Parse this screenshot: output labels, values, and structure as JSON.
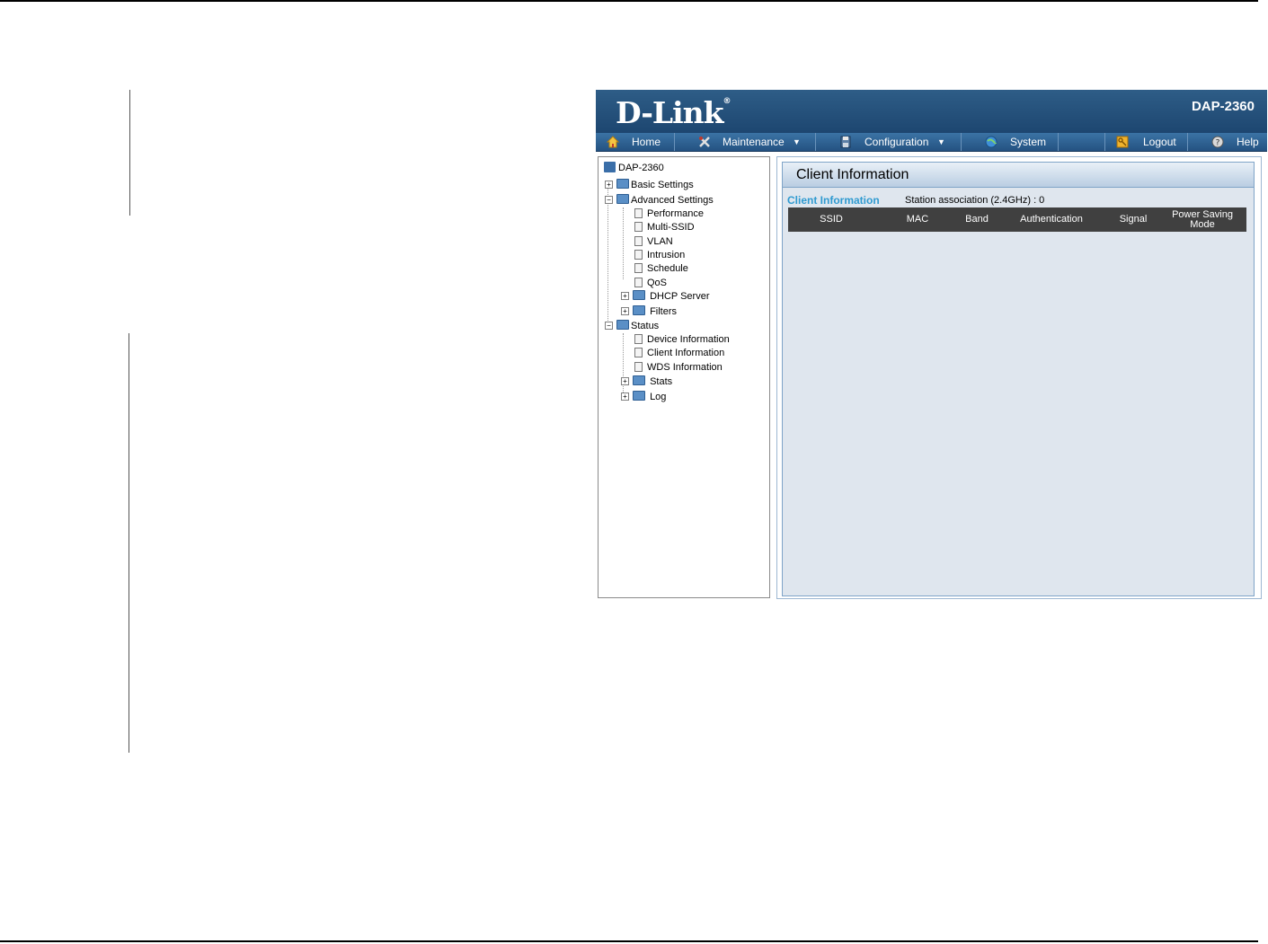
{
  "header": {
    "logo_text": "D-Link",
    "logo_mark": "®",
    "model": "DAP-2360"
  },
  "menu": {
    "items": [
      {
        "label": "Home",
        "icon": "home-icon"
      },
      {
        "label": "Maintenance",
        "icon": "tools-icon",
        "dropdown": true
      },
      {
        "label": "Configuration",
        "icon": "disk-icon",
        "dropdown": true
      },
      {
        "label": "System",
        "icon": "globe-icon"
      },
      {
        "label": "Logout",
        "icon": "key-icon"
      },
      {
        "label": "Help",
        "icon": "help-icon"
      }
    ]
  },
  "tree": {
    "root": "DAP-2360",
    "basic_settings": "Basic Settings",
    "advanced_settings": "Advanced Settings",
    "advanced_children": [
      "Performance",
      "Multi-SSID",
      "VLAN",
      "Intrusion",
      "Schedule",
      "QoS"
    ],
    "dhcp_server": "DHCP Server",
    "filters": "Filters",
    "status": "Status",
    "status_children": [
      "Device Information",
      "Client Information",
      "WDS Information"
    ],
    "stats": "Stats",
    "log": "Log"
  },
  "panel": {
    "title": "Client Information",
    "section_label": "Client Information",
    "station_association": "Station association (2.4GHz) :  0",
    "columns": [
      "SSID",
      "MAC",
      "Band",
      "Authentication",
      "Signal",
      "Power Saving Mode"
    ]
  }
}
